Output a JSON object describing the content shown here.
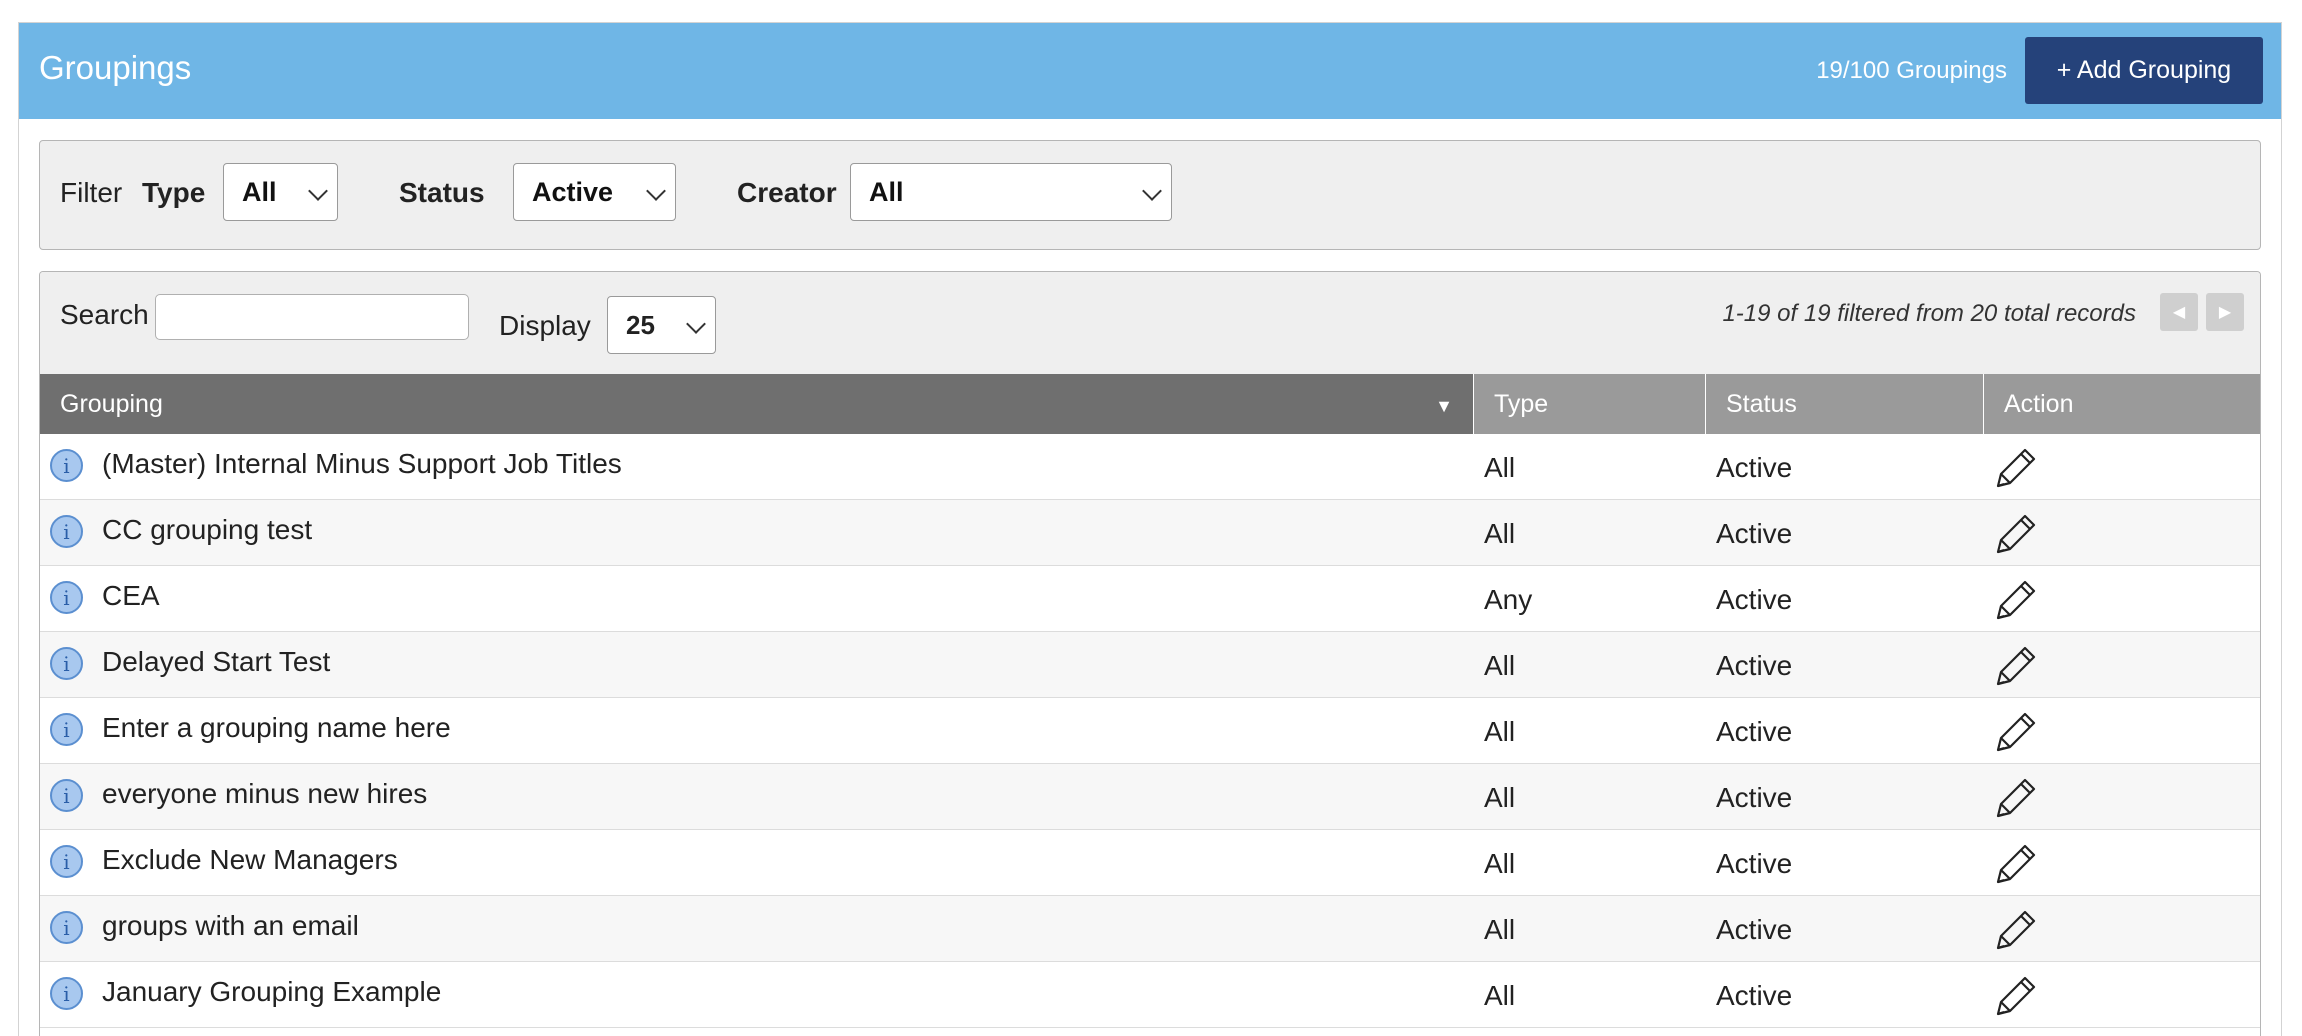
{
  "header": {
    "title": "Groupings",
    "count": "19/100 Groupings",
    "add_button": "+ Add Grouping"
  },
  "filter": {
    "label": "Filter",
    "type_label": "Type",
    "type_value": "All",
    "status_label": "Status",
    "status_value": "Active",
    "creator_label": "Creator",
    "creator_value": "All"
  },
  "toolbar": {
    "search_label": "Search",
    "search_value": "",
    "display_label": "Display",
    "display_value": "25",
    "records_text": "1-19 of 19 filtered from 20 total records",
    "prev_glyph": "◀",
    "next_glyph": "▶"
  },
  "table": {
    "columns": {
      "grouping": "Grouping",
      "type": "Type",
      "status": "Status",
      "action": "Action"
    },
    "sort_glyph": "▼",
    "info_glyph": "i",
    "rows": [
      {
        "name": "(Master) Internal Minus Support Job Titles",
        "type": "All",
        "status": "Active"
      },
      {
        "name": "CC grouping test",
        "type": "All",
        "status": "Active"
      },
      {
        "name": "CEA",
        "type": "Any",
        "status": "Active"
      },
      {
        "name": "Delayed Start Test",
        "type": "All",
        "status": "Active"
      },
      {
        "name": "Enter a grouping name here",
        "type": "All",
        "status": "Active"
      },
      {
        "name": "everyone minus new hires",
        "type": "All",
        "status": "Active"
      },
      {
        "name": "Exclude New Managers",
        "type": "All",
        "status": "Active"
      },
      {
        "name": "groups with an email",
        "type": "All",
        "status": "Active"
      },
      {
        "name": "January Grouping Example",
        "type": "All",
        "status": "Active"
      }
    ]
  },
  "icons": {
    "row_info": "info-icon",
    "row_action": "pencil-icon",
    "select_arrow": "chevron-down-icon"
  },
  "colors": {
    "header_bg": "#6fb6e6",
    "add_button_bg": "#25427a",
    "table_header_bg": "#9a9a9a",
    "sorted_header_bg": "#6f6f6f"
  }
}
